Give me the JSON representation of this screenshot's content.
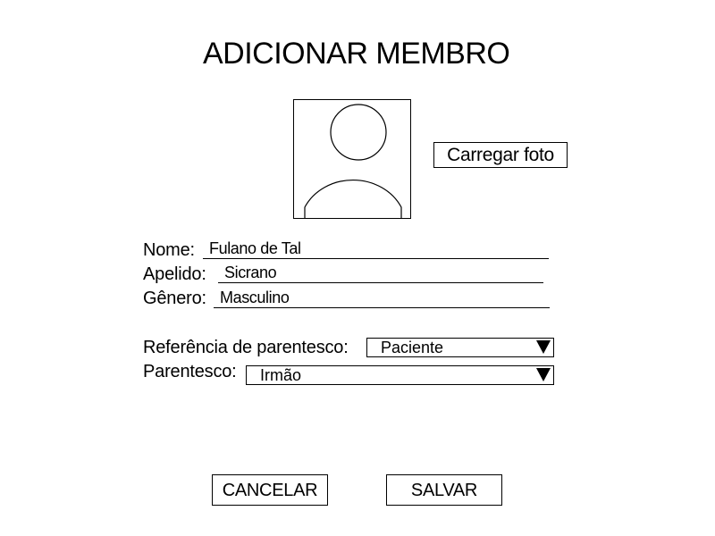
{
  "page": {
    "title": "ADICIONAR MEMBRO"
  },
  "photo": {
    "placeholder_icon": "user-silhouette-icon",
    "upload_label": "Carregar foto"
  },
  "form": {
    "name_label": "Nome:",
    "name_value": "Fulano de Tal",
    "surname_label": "Apelido:",
    "surname_value": "Sicrano",
    "gender_label": "Gênero:",
    "gender_value": "Masculino",
    "reference_label": "Referência de parentesco:",
    "reference_value": "Paciente",
    "relationship_label": "Parentesco:",
    "relationship_value": "Irmão",
    "dropdown_icon": "triangle-down-icon"
  },
  "actions": {
    "cancel_label": "CANCELAR",
    "save_label": "SALVAR"
  }
}
